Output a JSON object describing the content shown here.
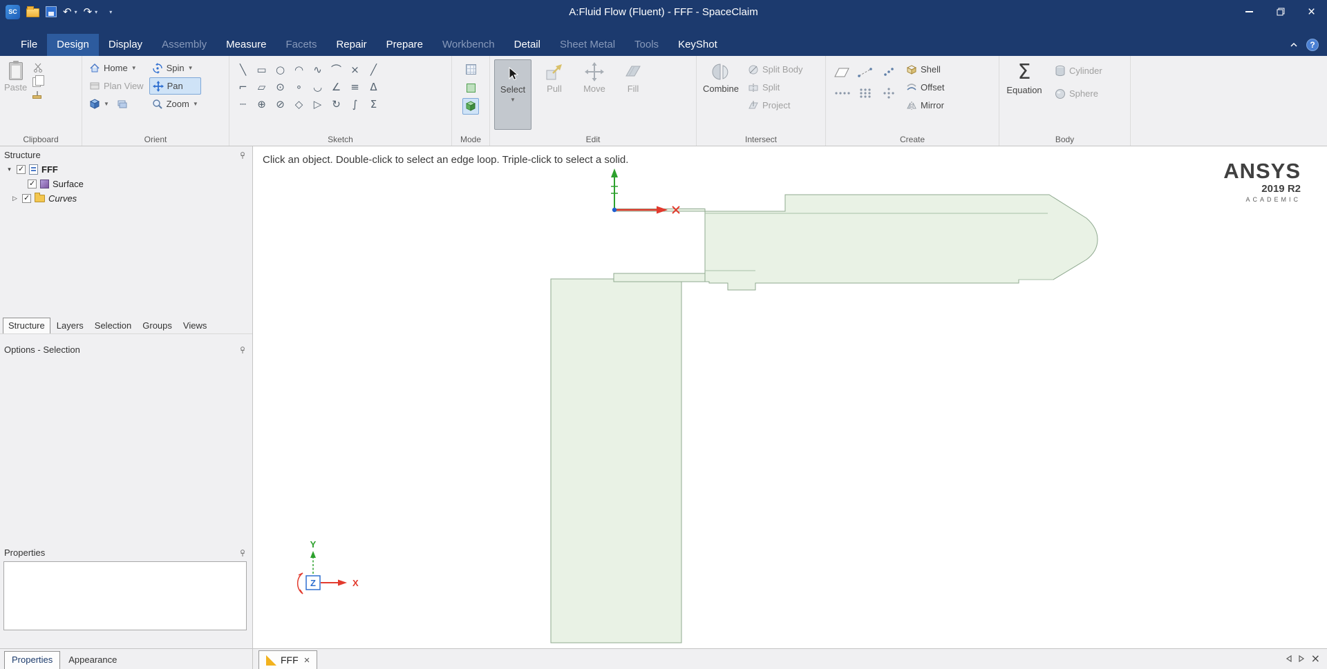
{
  "window": {
    "title": "A:Fluid Flow (Fluent) - FFF - SpaceClaim"
  },
  "menu": {
    "tabs": [
      {
        "label": "File",
        "state": "normal"
      },
      {
        "label": "Design",
        "state": "active"
      },
      {
        "label": "Display",
        "state": "normal"
      },
      {
        "label": "Assembly",
        "state": "disabled"
      },
      {
        "label": "Measure",
        "state": "normal"
      },
      {
        "label": "Facets",
        "state": "disabled"
      },
      {
        "label": "Repair",
        "state": "normal"
      },
      {
        "label": "Prepare",
        "state": "normal"
      },
      {
        "label": "Workbench",
        "state": "disabled"
      },
      {
        "label": "Detail",
        "state": "normal"
      },
      {
        "label": "Sheet Metal",
        "state": "disabled"
      },
      {
        "label": "Tools",
        "state": "disabled"
      },
      {
        "label": "KeyShot",
        "state": "normal"
      }
    ]
  },
  "ribbon": {
    "clipboard": {
      "label": "Clipboard",
      "paste": "Paste"
    },
    "orient": {
      "label": "Orient",
      "home": "Home",
      "spin": "Spin",
      "plan_view": "Plan View",
      "pan": "Pan",
      "zoom": "Zoom"
    },
    "sketch": {
      "label": "Sketch",
      "tools": [
        {
          "name": "line",
          "glyph": "╲"
        },
        {
          "name": "rectangle",
          "glyph": "▭"
        },
        {
          "name": "circle",
          "glyph": "○"
        },
        {
          "name": "arc",
          "glyph": "◠"
        },
        {
          "name": "spline",
          "glyph": "∿"
        },
        {
          "name": "tangent-arc",
          "glyph": "⌒"
        },
        {
          "name": "trim",
          "glyph": "×"
        },
        {
          "name": "mirror-line",
          "glyph": "╱"
        },
        {
          "name": "corner-line",
          "glyph": "⌐"
        },
        {
          "name": "three-point-rectangle",
          "glyph": "▱"
        },
        {
          "name": "center-circle",
          "glyph": "⊙"
        },
        {
          "name": "point",
          "glyph": "∘"
        },
        {
          "name": "sweep-arc",
          "glyph": "◡"
        },
        {
          "name": "angle",
          "glyph": "∠"
        },
        {
          "name": "offset-line",
          "glyph": "≡"
        },
        {
          "name": "chamfer",
          "glyph": "Δ"
        },
        {
          "name": "construction-line",
          "glyph": "┄"
        },
        {
          "name": "ellipse",
          "glyph": "⊕"
        },
        {
          "name": "split-curve",
          "glyph": "⊘"
        },
        {
          "name": "polygon",
          "glyph": "◇"
        },
        {
          "name": "project-curve",
          "glyph": "▷"
        },
        {
          "name": "rotate",
          "glyph": "↻"
        },
        {
          "name": "fillet",
          "glyph": "∫"
        },
        {
          "name": "equation-curve",
          "glyph": "Σ"
        }
      ]
    },
    "mode": {
      "label": "Mode"
    },
    "edit": {
      "label": "Edit",
      "select": "Select",
      "pull": "Pull",
      "move": "Move",
      "fill": "Fill"
    },
    "intersect": {
      "label": "Intersect",
      "combine": "Combine",
      "split_body": "Split Body",
      "split": "Split",
      "project": "Project"
    },
    "create": {
      "label": "Create",
      "shell": "Shell",
      "offset": "Offset",
      "mirror": "Mirror"
    },
    "body": {
      "label": "Body",
      "equation": "Equation",
      "cylinder": "Cylinder",
      "sphere": "Sphere"
    }
  },
  "sidebar": {
    "structure": {
      "header": "Structure",
      "tree": [
        {
          "label": "FFF"
        },
        {
          "label": "Surface"
        },
        {
          "label": "Curves"
        }
      ]
    },
    "tabs": [
      {
        "label": "Structure",
        "state": "active"
      },
      {
        "label": "Layers",
        "state": "normal"
      },
      {
        "label": "Selection",
        "state": "normal"
      },
      {
        "label": "Groups",
        "state": "normal"
      },
      {
        "label": "Views",
        "state": "normal"
      }
    ],
    "options": {
      "header": "Options - Selection"
    },
    "properties": {
      "header": "Properties"
    }
  },
  "canvas": {
    "hint": "Click an object. Double-click to select an edge loop. Triple-click to select a solid.",
    "logo": {
      "brand": "ANSYS",
      "version": "2019 R2",
      "edition": "ACADEMIC"
    },
    "triad": {
      "x": "X",
      "y": "Y",
      "z": "Z"
    }
  },
  "statusbar": {
    "left_tabs": [
      {
        "label": "Properties",
        "state": "active"
      },
      {
        "label": "Appearance",
        "state": "normal"
      }
    ],
    "doc_tabs": [
      {
        "label": "FFF"
      }
    ]
  },
  "colors": {
    "titlebar": "#1c3a6e",
    "active_tab": "#2d5b9e",
    "tool_highlight": "#cfe3f7",
    "geometry_fill": "#e9f2e5",
    "geometry_stroke": "#8fa98f",
    "axis_green": "#2da12d",
    "axis_red": "#e23b2e",
    "axis_blue": "#2f6fd0"
  }
}
